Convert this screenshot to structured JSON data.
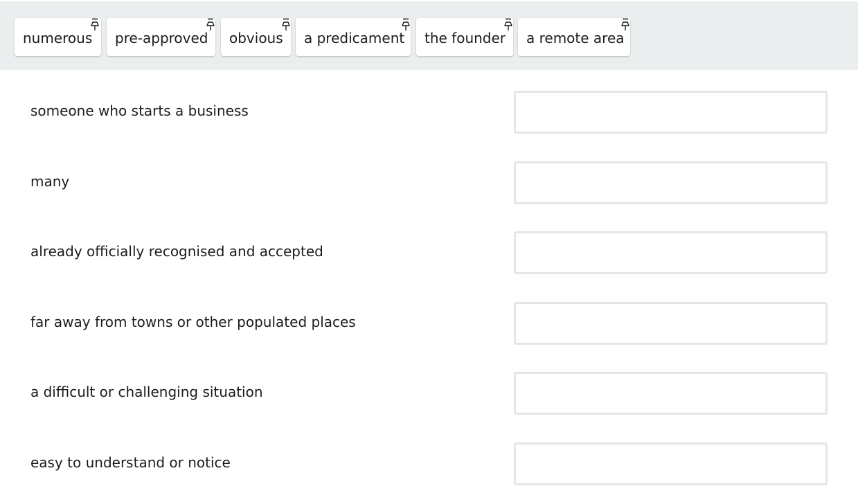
{
  "word_bank": {
    "tokens": [
      {
        "label": "numerous",
        "pin_icon": "pushpin-icon"
      },
      {
        "label": "pre-approved",
        "pin_icon": "pushpin-icon"
      },
      {
        "label": "obvious",
        "pin_icon": "pushpin-icon"
      },
      {
        "label": "a predicament",
        "pin_icon": "pushpin-icon"
      },
      {
        "label": "the founder",
        "pin_icon": "pushpin-icon"
      },
      {
        "label": "a remote area",
        "pin_icon": "pushpin-icon"
      }
    ]
  },
  "rows": [
    {
      "definition": "someone who starts a business",
      "answer": ""
    },
    {
      "definition": "many",
      "answer": ""
    },
    {
      "definition": "already officially recognised and accepted",
      "answer": ""
    },
    {
      "definition": "far away from towns or other populated places",
      "answer": ""
    },
    {
      "definition": "a difficult or challenging situation",
      "answer": ""
    },
    {
      "definition": "easy to understand or notice",
      "answer": ""
    }
  ],
  "colors": {
    "word_bank_background": "#ebeeee",
    "token_background": "#ffffff",
    "dropzone_border": "#e6e6e6",
    "text": "#1b1b1b"
  }
}
